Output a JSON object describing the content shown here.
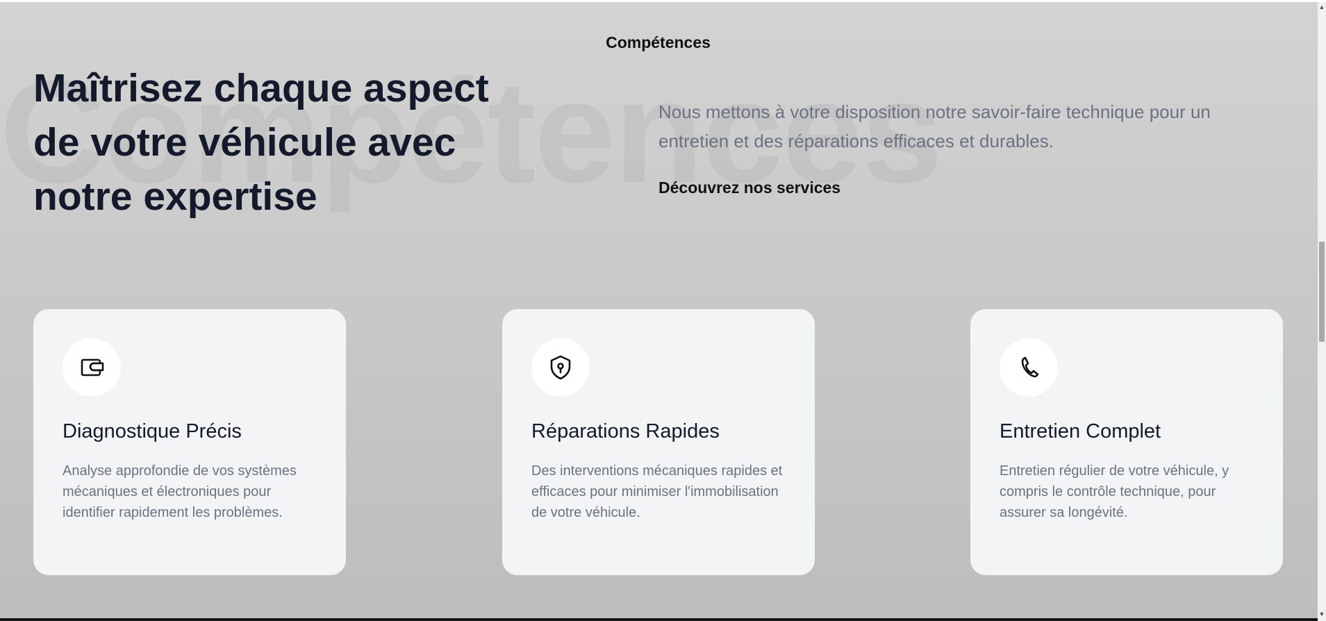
{
  "section": {
    "label": "Compétences",
    "watermark": "Compétences"
  },
  "hero": {
    "headline": "Maîtrisez chaque aspect de votre véhicule avec notre expertise",
    "intro": "Nous mettons à votre disposition notre savoir-faire technique pour un entretien et des réparations efficaces et durables.",
    "cta_label": "Découvrez nos services"
  },
  "cards": [
    {
      "icon": "wallet-icon",
      "title": "Diagnostique Précis",
      "description": "Analyse approfondie de vos systèmes mécaniques et électroniques pour identifier rapidement les problèmes."
    },
    {
      "icon": "shield-keyhole-icon",
      "title": "Réparations Rapides",
      "description": "Des interventions mécaniques rapides et efficaces pour minimiser l'immobilisation de votre véhicule."
    },
    {
      "icon": "phone-icon",
      "title": "Entretien Complet",
      "description": "Entretien régulier de votre véhicule, y compris le contrôle technique, pour assurer sa longévité."
    }
  ],
  "scrollbar": {
    "up_arrow": "▲",
    "down_arrow": "▼",
    "position": 0.43
  }
}
